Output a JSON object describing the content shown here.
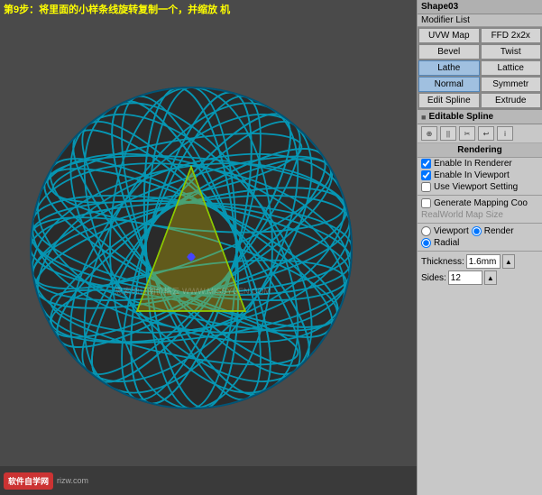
{
  "viewport": {
    "label": "第9步：将里面的小样条线旋转复制一个，并缩放\n机",
    "watermark1": "思索你订阅价格云 WWW.MISSYUEN.COM",
    "watermark2": ""
  },
  "panel": {
    "title": "Shape03",
    "subtitle": "Modifier List",
    "modifiers": [
      {
        "label": "UVW Map",
        "col": 1
      },
      {
        "label": "FFD 2x2x",
        "col": 2
      },
      {
        "label": "Bevel",
        "col": 1
      },
      {
        "label": "Twist",
        "col": 2
      },
      {
        "label": "Lathe",
        "col": 1,
        "active": true
      },
      {
        "label": "Lattice",
        "col": 2
      },
      {
        "label": "Normal",
        "col": 1,
        "active": true
      },
      {
        "label": "Symmetr",
        "col": 2
      },
      {
        "label": "Edit Spline",
        "col": 1
      },
      {
        "label": "Extrude",
        "col": 2
      }
    ],
    "editableSpline": "Editable Spline",
    "rendering": {
      "header": "Rendering",
      "options": [
        {
          "type": "checkbox",
          "checked": true,
          "label": "Enable In Renderer"
        },
        {
          "type": "checkbox",
          "checked": true,
          "label": "Enable In Viewport"
        },
        {
          "type": "checkbox",
          "checked": false,
          "label": "Use Viewport Setting"
        },
        {
          "type": "checkbox",
          "checked": false,
          "label": "Generate Mapping Coo"
        },
        {
          "type": "text",
          "label": "RealWorld Map Size",
          "disabled": true
        },
        {
          "type": "radio-group",
          "options": [
            "Viewport",
            "Render"
          ],
          "selected": 1
        },
        {
          "type": "radio",
          "checked": true,
          "label": "Radial"
        },
        {
          "type": "field",
          "label": "Thickness:",
          "value": "1.6mm"
        },
        {
          "type": "field",
          "label": "Sides:",
          "value": "12"
        }
      ]
    }
  },
  "logos": [
    {
      "text": "软件自学网"
    },
    {
      "text": "rizw.com"
    }
  ]
}
